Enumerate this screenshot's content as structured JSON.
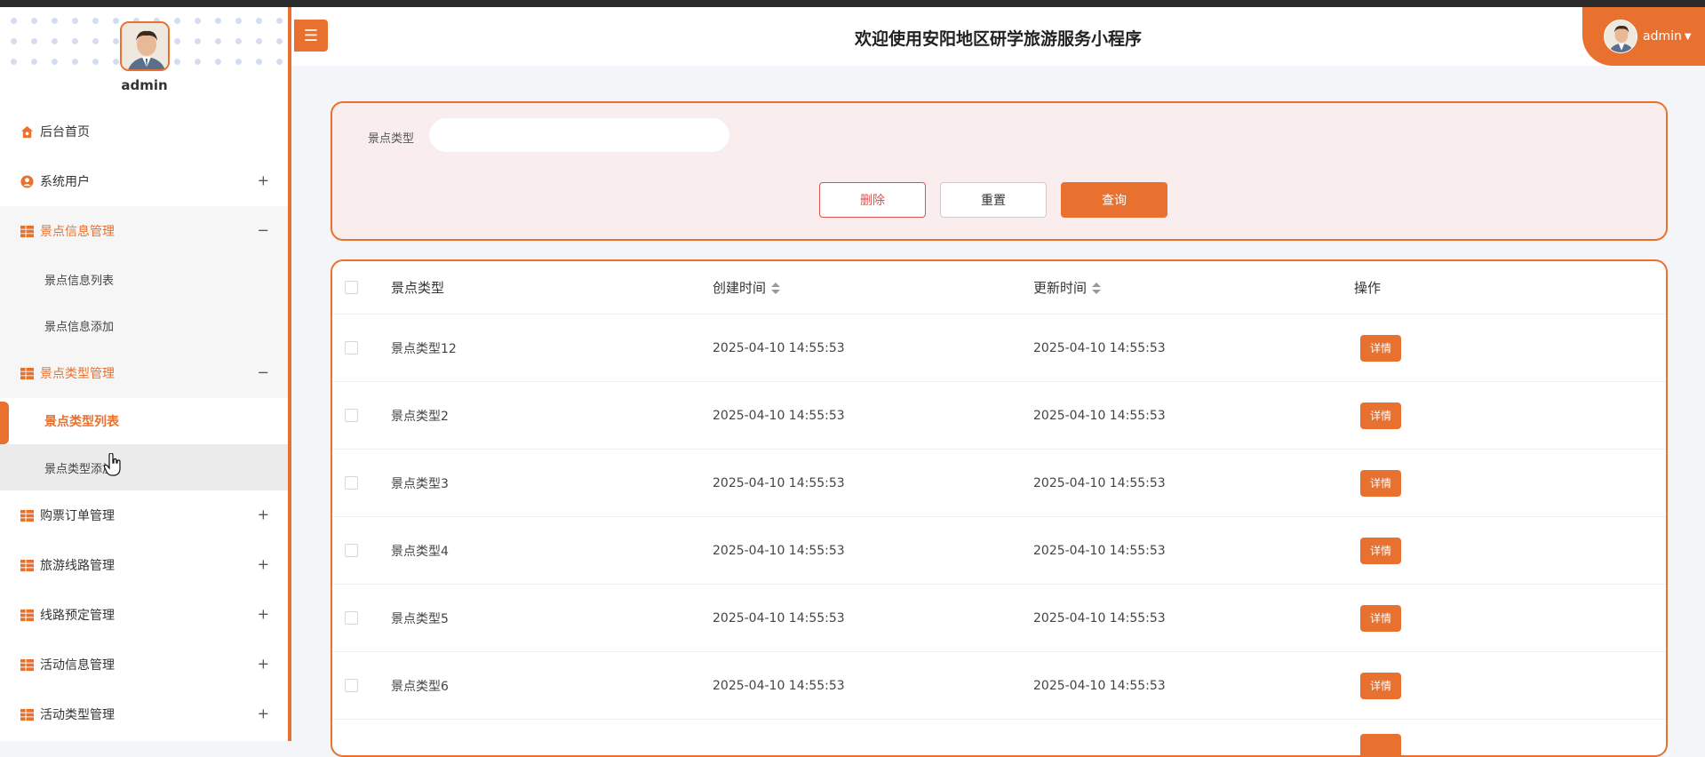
{
  "sidebar": {
    "user_name": "admin",
    "items": [
      {
        "label": "后台首页",
        "icon": "home-icon",
        "toggle": ""
      },
      {
        "label": "系统用户",
        "icon": "user-icon",
        "toggle": "+"
      },
      {
        "label": "景点信息管理",
        "icon": "grid-icon",
        "toggle": "−"
      },
      {
        "label": "景点类型管理",
        "icon": "grid-icon",
        "toggle": "−"
      },
      {
        "label": "购票订单管理",
        "icon": "grid-icon",
        "toggle": "+"
      },
      {
        "label": "旅游线路管理",
        "icon": "grid-icon",
        "toggle": "+"
      },
      {
        "label": "线路预定管理",
        "icon": "grid-icon",
        "toggle": "+"
      },
      {
        "label": "活动信息管理",
        "icon": "grid-icon",
        "toggle": "+"
      },
      {
        "label": "活动类型管理",
        "icon": "grid-icon",
        "toggle": "+"
      }
    ],
    "sub_spot_info": [
      "景点信息列表",
      "景点信息添加"
    ],
    "sub_spot_type": [
      "景点类型列表",
      "景点类型添加"
    ]
  },
  "header": {
    "title": "欢迎使用安阳地区研学旅游服务小程序",
    "user": "admin",
    "menu_icon": "hamburger-icon"
  },
  "search": {
    "label": "景点类型",
    "value": "",
    "delete_label": "删除",
    "reset_label": "重置",
    "query_label": "查询"
  },
  "table": {
    "columns": [
      "景点类型",
      "创建时间",
      "更新时间",
      "操作"
    ],
    "rows": [
      {
        "type": "景点类型12",
        "created": "2025-04-10 14:55:53",
        "updated": "2025-04-10 14:55:53",
        "action": "详情"
      },
      {
        "type": "景点类型2",
        "created": "2025-04-10 14:55:53",
        "updated": "2025-04-10 14:55:53",
        "action": "详情"
      },
      {
        "type": "景点类型3",
        "created": "2025-04-10 14:55:53",
        "updated": "2025-04-10 14:55:53",
        "action": "详情"
      },
      {
        "type": "景点类型4",
        "created": "2025-04-10 14:55:53",
        "updated": "2025-04-10 14:55:53",
        "action": "详情"
      },
      {
        "type": "景点类型5",
        "created": "2025-04-10 14:55:53",
        "updated": "2025-04-10 14:55:53",
        "action": "详情"
      },
      {
        "type": "景点类型6",
        "created": "2025-04-10 14:55:53",
        "updated": "2025-04-10 14:55:53",
        "action": "详情"
      }
    ]
  },
  "colors": {
    "accent": "#e8712f",
    "danger": "#d9534f",
    "panel": "#f9eeed"
  }
}
